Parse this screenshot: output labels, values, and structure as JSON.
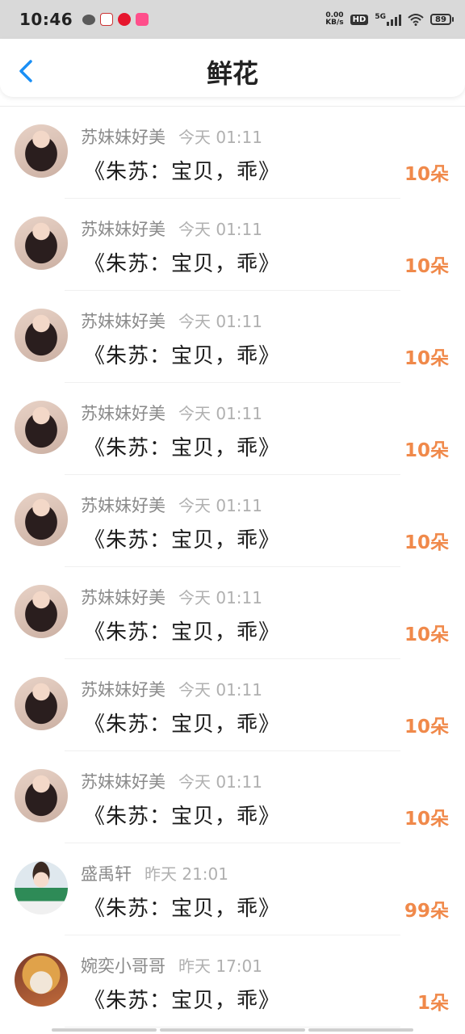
{
  "status_bar": {
    "time": "10:46",
    "net_speed_value": "0.00",
    "net_speed_unit": "KB/s",
    "hd_label": "HD",
    "signal_label": "5G",
    "battery_level": "89"
  },
  "header": {
    "title": "鲜花"
  },
  "colors": {
    "accent_blue": "#1a8ff5",
    "count_orange": "#f0894a"
  },
  "items": [
    {
      "username": "苏妹妹好美",
      "time": "今天 01:11",
      "gift": "《朱苏：宝贝，乖》",
      "count": "10朵",
      "avatar": "avatar-girl"
    },
    {
      "username": "苏妹妹好美",
      "time": "今天 01:11",
      "gift": "《朱苏：宝贝，乖》",
      "count": "10朵",
      "avatar": "avatar-girl"
    },
    {
      "username": "苏妹妹好美",
      "time": "今天 01:11",
      "gift": "《朱苏：宝贝，乖》",
      "count": "10朵",
      "avatar": "avatar-girl"
    },
    {
      "username": "苏妹妹好美",
      "time": "今天 01:11",
      "gift": "《朱苏：宝贝，乖》",
      "count": "10朵",
      "avatar": "avatar-girl"
    },
    {
      "username": "苏妹妹好美",
      "time": "今天 01:11",
      "gift": "《朱苏：宝贝，乖》",
      "count": "10朵",
      "avatar": "avatar-girl"
    },
    {
      "username": "苏妹妹好美",
      "time": "今天 01:11",
      "gift": "《朱苏：宝贝，乖》",
      "count": "10朵",
      "avatar": "avatar-girl"
    },
    {
      "username": "苏妹妹好美",
      "time": "今天 01:11",
      "gift": "《朱苏：宝贝，乖》",
      "count": "10朵",
      "avatar": "avatar-girl"
    },
    {
      "username": "苏妹妹好美",
      "time": "今天 01:11",
      "gift": "《朱苏：宝贝，乖》",
      "count": "10朵",
      "avatar": "avatar-girl"
    },
    {
      "username": "盛禹轩",
      "time": "昨天 21:01",
      "gift": "《朱苏：宝贝，乖》",
      "count": "99朵",
      "avatar": "avatar-boy"
    },
    {
      "username": "婉奕小哥哥",
      "time": "昨天 17:01",
      "gift": "《朱苏：宝贝，乖》",
      "count": "1朵",
      "avatar": "avatar-cat"
    }
  ]
}
